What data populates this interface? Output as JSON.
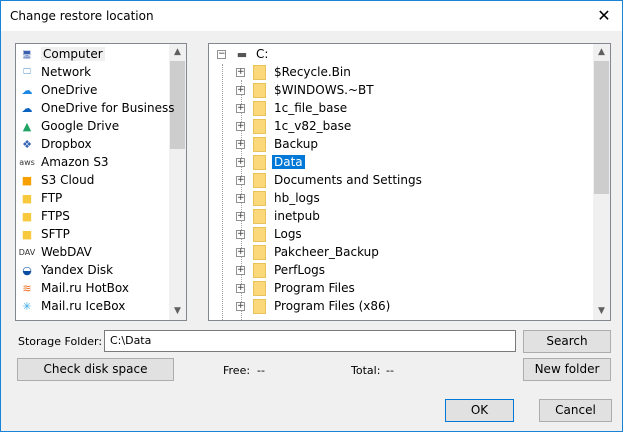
{
  "title": "Change restore location",
  "sources": [
    {
      "label": "Computer",
      "icon": "computer-icon",
      "glyph": "🖥",
      "color": "#3a5fb0"
    },
    {
      "label": "Network",
      "icon": "network-icon",
      "glyph": "🖵",
      "color": "#4a8ac8"
    },
    {
      "label": "OneDrive",
      "icon": "onedrive-icon",
      "glyph": "☁",
      "color": "#1e88e5"
    },
    {
      "label": "OneDrive for Business",
      "icon": "onedrive-business-icon",
      "glyph": "☁",
      "color": "#0b63c1"
    },
    {
      "label": "Google Drive",
      "icon": "google-drive-icon",
      "glyph": "▲",
      "color": "#1fa463"
    },
    {
      "label": "Dropbox",
      "icon": "dropbox-icon",
      "glyph": "❖",
      "color": "#3565b5"
    },
    {
      "label": "Amazon S3",
      "icon": "aws-icon",
      "glyph": "aws",
      "color": "#333"
    },
    {
      "label": "S3 Cloud",
      "icon": "s3-cloud-icon",
      "glyph": "■",
      "color": "#f7a000"
    },
    {
      "label": "FTP",
      "icon": "ftp-folder-icon",
      "glyph": "■",
      "color": "#f8c93c"
    },
    {
      "label": "FTPS",
      "icon": "ftps-folder-icon",
      "glyph": "■",
      "color": "#f8c93c"
    },
    {
      "label": "SFTP",
      "icon": "sftp-folder-icon",
      "glyph": "■",
      "color": "#f8c93c"
    },
    {
      "label": "WebDAV",
      "icon": "webdav-icon",
      "glyph": "DAV",
      "color": "#333"
    },
    {
      "label": "Yandex Disk",
      "icon": "yandex-disk-icon",
      "glyph": "◒",
      "color": "#0b4ea2"
    },
    {
      "label": "Mail.ru HotBox",
      "icon": "hotbox-icon",
      "glyph": "≋",
      "color": "#f26b1d"
    },
    {
      "label": "Mail.ru IceBox",
      "icon": "icebox-icon",
      "glyph": "✳",
      "color": "#39a9e6"
    }
  ],
  "tree": {
    "root": "C:",
    "folders": [
      "$Recycle.Bin",
      "$WINDOWS.~BT",
      "1c_file_base",
      "1c_v82_base",
      "Backup",
      "Data",
      "Documents and Settings",
      "hb_logs",
      "inetpub",
      "Logs",
      "Pakcheer_Backup",
      "PerfLogs",
      "Program Files",
      "Program Files (x86)"
    ],
    "selected": "Data"
  },
  "storage": {
    "label": "Storage Folder:",
    "value": "C:\\Data"
  },
  "buttons": {
    "search": "Search",
    "check": "Check disk space",
    "new_folder": "New folder",
    "ok": "OK",
    "cancel": "Cancel"
  },
  "free": {
    "label": "Free:",
    "value": "--"
  },
  "total": {
    "label": "Total:",
    "value": "--"
  }
}
